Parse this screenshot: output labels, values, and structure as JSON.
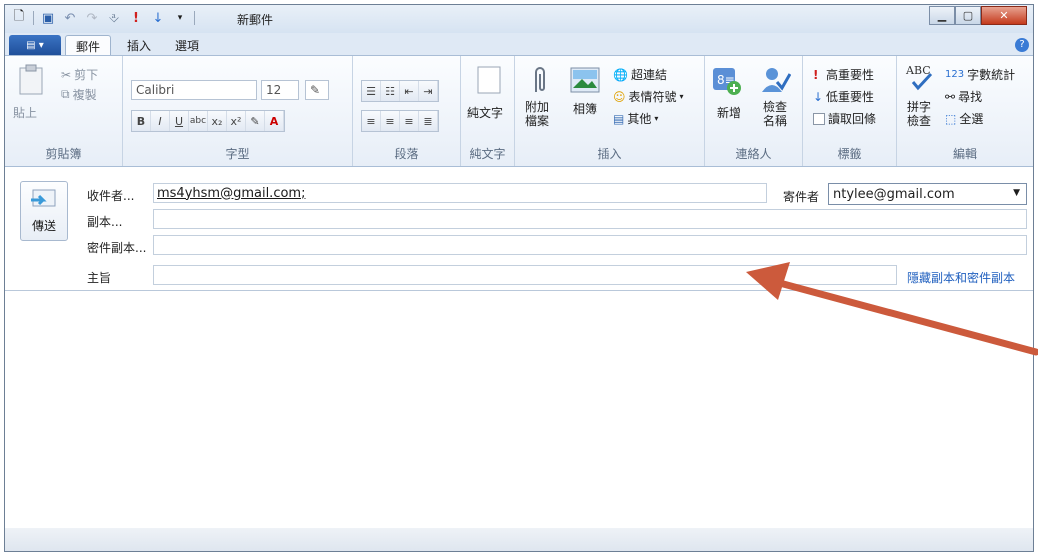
{
  "window": {
    "title": "新郵件",
    "qat_icons": [
      "new-message-icon",
      "save-icon",
      "undo-icon",
      "redo-icon",
      "attach-icon",
      "high-priority-icon",
      "low-priority-icon",
      "customize-qat-icon"
    ]
  },
  "tabs": [
    "郵件",
    "插入",
    "選項"
  ],
  "ribbon": {
    "clipboard": {
      "label": "剪貼簿",
      "paste": "貼上",
      "cut": "剪下",
      "copy": "複製"
    },
    "font": {
      "label": "字型",
      "font_name": "Calibri",
      "font_size": "12"
    },
    "paragraph": {
      "label": "段落"
    },
    "plaintext": {
      "label": "純文字",
      "button": "純文字"
    },
    "insert": {
      "label": "插入",
      "attach": "附加\n檔案",
      "album": "相簿",
      "hyperlink": "超連結",
      "emoticon": "表情符號",
      "other": "其他"
    },
    "contacts": {
      "label": "連絡人",
      "add": "新增",
      "check": "檢查\n名稱"
    },
    "tags": {
      "label": "標籤",
      "high": "高重要性",
      "low": "低重要性",
      "receipt": "讀取回條"
    },
    "editing": {
      "label": "編輯",
      "spell": "拼字\n檢查",
      "wordcount": "字數統計",
      "find": "尋找",
      "selectall": "全選"
    }
  },
  "compose": {
    "send": "傳送",
    "to_label": "收件者...",
    "to_value": "ms4yhsm@gmail.com;",
    "cc_label": "副本...",
    "bcc_label": "密件副本...",
    "subject_label": "主旨",
    "from_label": "寄件者",
    "from_value": "ntylee@gmail.com",
    "hide_cc_bcc": "隱藏副本和密件副本"
  },
  "colors": {
    "accent": "#1f5fbf",
    "annotation_arrow": "#cc5a3c"
  }
}
